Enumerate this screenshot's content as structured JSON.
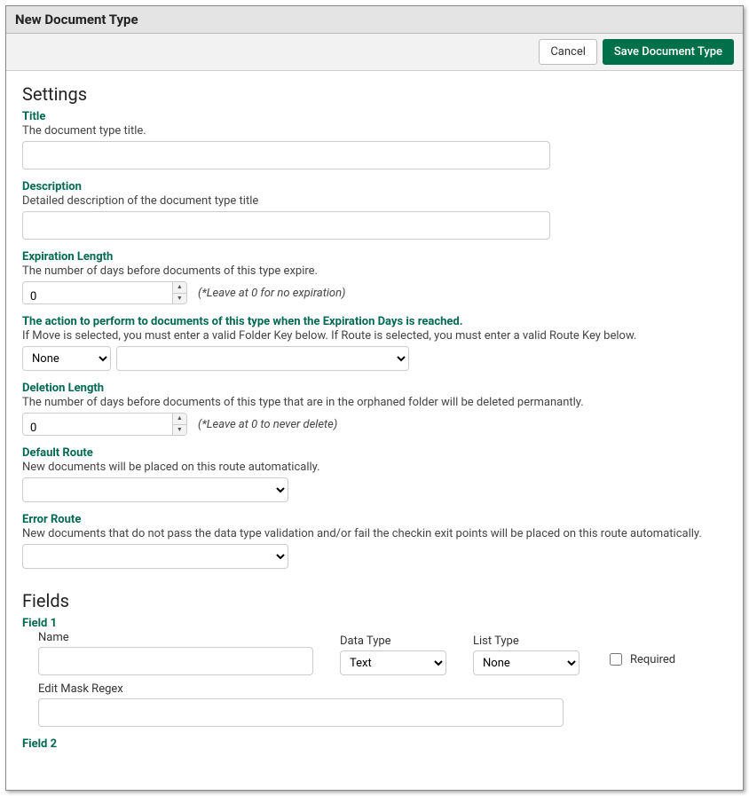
{
  "window": {
    "title": "New Document Type"
  },
  "toolbar": {
    "cancel": "Cancel",
    "save": "Save Document Type"
  },
  "sections": {
    "settings": "Settings",
    "fields": "Fields"
  },
  "settings": {
    "title": {
      "label": "Title",
      "help": "The document type title.",
      "value": ""
    },
    "description": {
      "label": "Description",
      "help": "Detailed description of the document type title",
      "value": ""
    },
    "expiration": {
      "label": "Expiration Length",
      "help": "The number of days before documents of this type expire.",
      "value": "0",
      "hint": "(*Leave at 0 for no expiration)"
    },
    "expirationAction": {
      "label": "The action to perform to documents of this type when the Expiration Days is reached.",
      "help": "If Move is selected, you must enter a valid Folder Key below. If Route is selected, you must enter a valid Route Key below.",
      "action": "None",
      "target": ""
    },
    "deletion": {
      "label": "Deletion Length",
      "help": "The number of days before documents of this type that are in the orphaned folder will be deleted permanantly.",
      "value": "0",
      "hint": "(*Leave at 0 to never delete)"
    },
    "defaultRoute": {
      "label": "Default Route",
      "help": "New documents will be placed on this route automatically.",
      "value": ""
    },
    "errorRoute": {
      "label": "Error Route",
      "help": "New documents that do not pass the data type validation and/or fail the checkin exit points will be placed on this route automatically.",
      "value": ""
    }
  },
  "fields": {
    "f1": {
      "heading": "Field 1",
      "name_label": "Name",
      "name_value": "",
      "datatype_label": "Data Type",
      "datatype_value": "Text",
      "listtype_label": "List Type",
      "listtype_value": "None",
      "required_label": "Required",
      "editmask_label": "Edit Mask Regex",
      "editmask_value": ""
    },
    "f2": {
      "heading": "Field 2"
    }
  }
}
